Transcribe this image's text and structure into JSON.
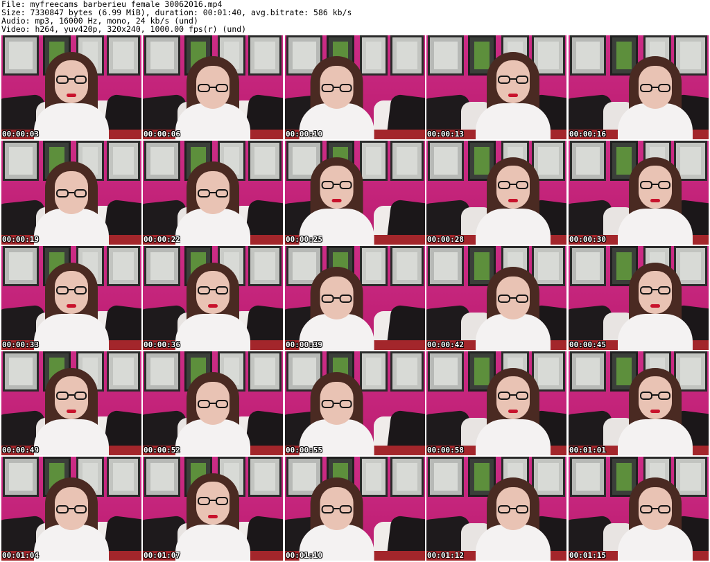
{
  "header": {
    "file": "File: myfreecams_barberieu_female_30062016.mp4",
    "size": "Size: 7330847 bytes (6.99 MiB), duration: 00:01:40, avg.bitrate: 586 kb/s",
    "audio": "Audio: mp3, 16000 Hz, mono, 24 kb/s (und)",
    "video": "Video: h264, yuv420p, 320x240, 1000.00 fps(r) (und)"
  },
  "thumbnails": [
    {
      "timestamp": "00:00:03",
      "pose": "front"
    },
    {
      "timestamp": "00:00:06",
      "pose": "down"
    },
    {
      "timestamp": "00:00:10",
      "pose": "down"
    },
    {
      "timestamp": "00:00:13",
      "pose": "front"
    },
    {
      "timestamp": "00:00:16",
      "pose": "down"
    },
    {
      "timestamp": "00:00:19",
      "pose": "down"
    },
    {
      "timestamp": "00:00:22",
      "pose": "down"
    },
    {
      "timestamp": "00:00:25",
      "pose": "front"
    },
    {
      "timestamp": "00:00:28",
      "pose": "front"
    },
    {
      "timestamp": "00:00:30",
      "pose": "front"
    },
    {
      "timestamp": "00:00:33",
      "pose": "front"
    },
    {
      "timestamp": "00:00:36",
      "pose": "front"
    },
    {
      "timestamp": "00:00:39",
      "pose": "down"
    },
    {
      "timestamp": "00:00:42",
      "pose": "down"
    },
    {
      "timestamp": "00:00:45",
      "pose": "front"
    },
    {
      "timestamp": "00:00:49",
      "pose": "front"
    },
    {
      "timestamp": "00:00:52",
      "pose": "down"
    },
    {
      "timestamp": "00:00:55",
      "pose": "down"
    },
    {
      "timestamp": "00:00:58",
      "pose": "front"
    },
    {
      "timestamp": "00:01:01",
      "pose": "front"
    },
    {
      "timestamp": "00:01:04",
      "pose": "down"
    },
    {
      "timestamp": "00:01:07",
      "pose": "front"
    },
    {
      "timestamp": "00:01:10",
      "pose": "down"
    },
    {
      "timestamp": "00:01:12",
      "pose": "down"
    },
    {
      "timestamp": "00:01:15",
      "pose": "down"
    }
  ],
  "colors": {
    "wall": "#c8277a",
    "floor": "#a3262b",
    "shirt": "#f4f2f2",
    "hair": "#4a2a22",
    "lips": "#c8122c"
  }
}
